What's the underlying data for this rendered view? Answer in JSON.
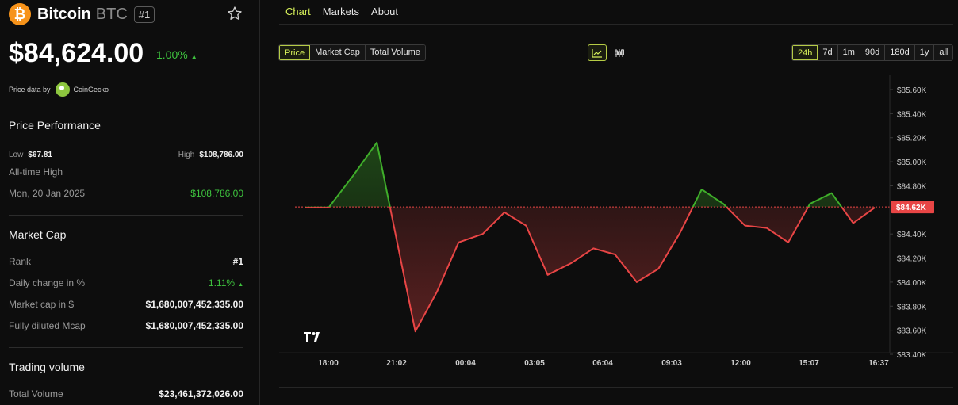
{
  "coin": {
    "logo_glyph": "₿",
    "name": "Bitcoin",
    "symbol": "BTC",
    "rank_badge": "#1",
    "price": "$84,624.00",
    "change": "1.00%",
    "change_arrow": "▲",
    "price_data_by": "Price data by",
    "provider": "CoinGecko"
  },
  "performance": {
    "title": "Price Performance",
    "low_label": "Low",
    "low_value": "$67.81",
    "high_label": "High",
    "high_value": "$108,786.00",
    "ath_label": "All-time High",
    "ath_date": "Mon, 20 Jan 2025",
    "ath_value": "$108,786.00"
  },
  "market_cap": {
    "title": "Market Cap",
    "rank_label": "Rank",
    "rank_value": "#1",
    "daily_label": "Daily change in %",
    "daily_value": "1.11%",
    "daily_arrow": "▲",
    "mcap_label": "Market cap in $",
    "mcap_value": "$1,680,007,452,335.00",
    "fdv_label": "Fully diluted Mcap",
    "fdv_value": "$1,680,007,452,335.00"
  },
  "trading": {
    "title": "Trading volume",
    "total_label": "Total Volume",
    "total_value": "$23,461,372,026.00"
  },
  "tabs": [
    {
      "label": "Chart",
      "active": true
    },
    {
      "label": "Markets",
      "active": false
    },
    {
      "label": "About",
      "active": false
    }
  ],
  "metric_buttons": [
    {
      "label": "Price",
      "active": true
    },
    {
      "label": "Market Cap",
      "active": false
    },
    {
      "label": "Total Volume",
      "active": false
    }
  ],
  "view_buttons": [
    {
      "icon": "line-chart-icon",
      "active": true
    },
    {
      "icon": "candlestick-icon",
      "active": false
    }
  ],
  "range_buttons": [
    {
      "label": "24h",
      "active": true
    },
    {
      "label": "7d",
      "active": false
    },
    {
      "label": "1m",
      "active": false
    },
    {
      "label": "90d",
      "active": false
    },
    {
      "label": "180d",
      "active": false
    },
    {
      "label": "1y",
      "active": false
    },
    {
      "label": "all",
      "active": false
    }
  ],
  "colors": {
    "accent": "#d6f05a",
    "up": "#3fae2a",
    "down": "#e84545",
    "reference": "#e84545",
    "current_badge": "#e84545"
  },
  "chart_data": {
    "type": "line",
    "x_tick_labels": [
      "18:00",
      "21:02",
      "00:04",
      "03:05",
      "06:04",
      "09:03",
      "12:00",
      "15:07",
      "16:37"
    ],
    "y_tick_labels": [
      "$85.60K",
      "$85.40K",
      "$85.20K",
      "$85.00K",
      "$84.80K",
      "$84.60K",
      "$84.40K",
      "$84.20K",
      "$84.00K",
      "$83.80K",
      "$83.60K",
      "$83.40K"
    ],
    "y_ticks": [
      85600,
      85400,
      85200,
      85000,
      84800,
      84400,
      84200,
      84000,
      83800,
      83600,
      83400
    ],
    "ylim": [
      83400,
      85600
    ],
    "x_range_hours": [
      -0.4,
      23.0
    ],
    "reference_value": 84624,
    "current_label": "$84.62K",
    "points": [
      {
        "t": 0.0,
        "v": 84620
      },
      {
        "t": 1.0,
        "v": 84620
      },
      {
        "t": 2.0,
        "v": 84880
      },
      {
        "t": 3.0,
        "v": 85160
      },
      {
        "t": 4.6,
        "v": 83590
      },
      {
        "t": 5.5,
        "v": 83920
      },
      {
        "t": 6.4,
        "v": 84330
      },
      {
        "t": 7.4,
        "v": 84400
      },
      {
        "t": 8.3,
        "v": 84580
      },
      {
        "t": 9.2,
        "v": 84470
      },
      {
        "t": 10.1,
        "v": 84060
      },
      {
        "t": 11.1,
        "v": 84160
      },
      {
        "t": 12.0,
        "v": 84280
      },
      {
        "t": 12.9,
        "v": 84230
      },
      {
        "t": 13.8,
        "v": 84000
      },
      {
        "t": 14.7,
        "v": 84110
      },
      {
        "t": 15.6,
        "v": 84410
      },
      {
        "t": 16.5,
        "v": 84770
      },
      {
        "t": 17.4,
        "v": 84650
      },
      {
        "t": 18.3,
        "v": 84470
      },
      {
        "t": 19.2,
        "v": 84450
      },
      {
        "t": 20.1,
        "v": 84330
      },
      {
        "t": 21.0,
        "v": 84650
      },
      {
        "t": 21.9,
        "v": 84740
      },
      {
        "t": 22.8,
        "v": 84490
      },
      {
        "t": 23.7,
        "v": 84620
      }
    ]
  }
}
